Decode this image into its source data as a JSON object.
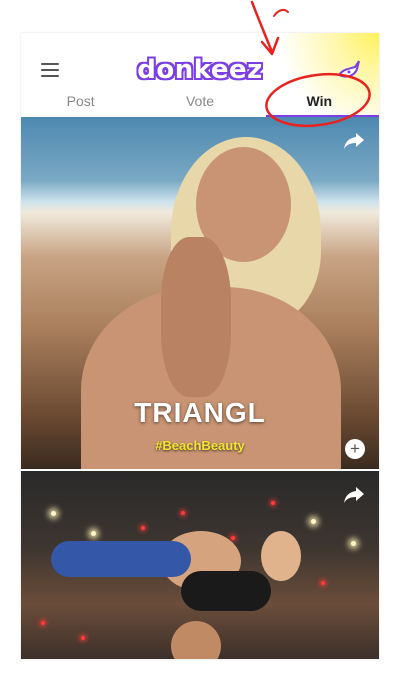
{
  "app": {
    "logo_text": "donkeez"
  },
  "tabs": [
    {
      "label": "Post"
    },
    {
      "label": "Vote"
    },
    {
      "label": "Win",
      "active": true
    }
  ],
  "posts": [
    {
      "title": "TRIANGL",
      "hashtag": "#BeachBeauty"
    },
    {
      "title": "",
      "hashtag": ""
    }
  ],
  "colors": {
    "brand": "#7b3fe4",
    "hashtag": "#f5e533",
    "annotation": "#e8231f"
  },
  "icons": [
    "menu-icon",
    "mascot-icon",
    "share-icon",
    "plus-icon"
  ]
}
